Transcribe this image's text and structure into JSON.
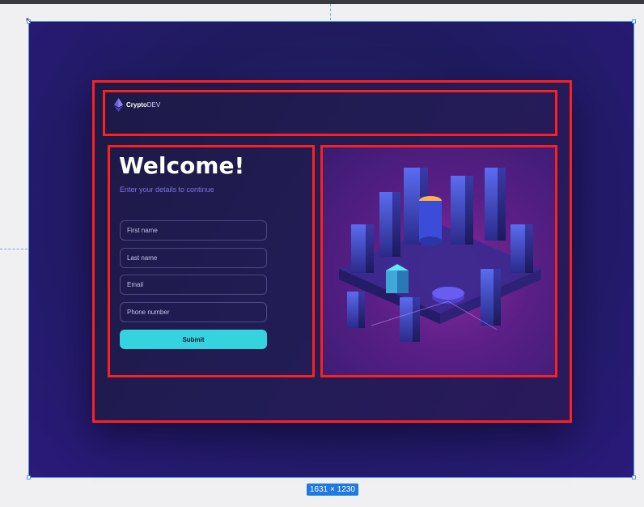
{
  "canvas": {
    "dimensions_label": "1631 × 1230"
  },
  "brand": {
    "name_bold": "Crypto",
    "name_light": "DEV",
    "icon": "ethereum-diamond-icon"
  },
  "form": {
    "title": "Welcome!",
    "subtitle": "Enter your details to continue",
    "fields": [
      {
        "placeholder": "First name"
      },
      {
        "placeholder": "Last name"
      },
      {
        "placeholder": "Email"
      },
      {
        "placeholder": "Phone number"
      }
    ],
    "submit_label": "Submit"
  },
  "illustration": {
    "icon": "isometric-crypto-city-illustration"
  },
  "colors": {
    "accent": "#35d3dd",
    "subtitle": "#7f74e6",
    "outline": "#ff1f1f",
    "selection": "#4d8fe8"
  }
}
